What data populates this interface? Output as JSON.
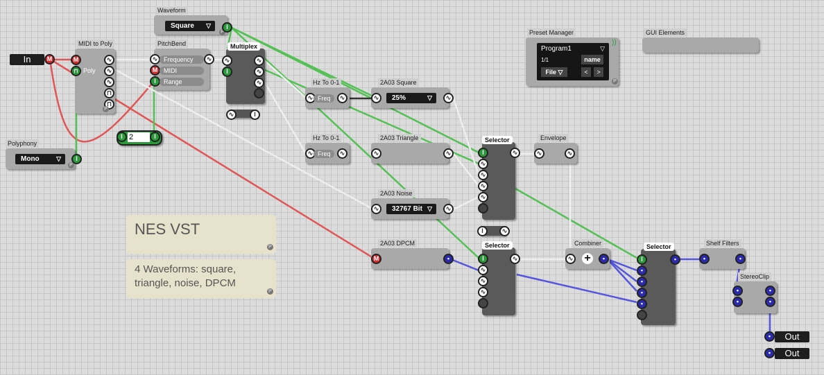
{
  "io": {
    "in_label": "In",
    "out_label": "Out"
  },
  "modules": {
    "waveform": {
      "title": "Waveform",
      "value": "Square"
    },
    "midi_to_poly": {
      "title": "MIDI to Poly",
      "poly_label": "Poly"
    },
    "pitchbend": {
      "title": "PitchBend",
      "frequency": "Frequency",
      "midi": "MIDI",
      "range": "Range"
    },
    "multiplex": {
      "title": "Multiplex"
    },
    "polyphony": {
      "title": "Polyphony",
      "value": "Mono"
    },
    "number_box": {
      "value": "2"
    },
    "hz_to_01_a": {
      "title": "Hz To 0-1",
      "port": "Freq"
    },
    "hz_to_01_b": {
      "title": "Hz To 0-1",
      "port": "Freq"
    },
    "square": {
      "title": "2A03 Square",
      "value": "25%"
    },
    "triangle": {
      "title": "2A03 Triangle"
    },
    "noise": {
      "title": "2A03 Noise",
      "value": "32767 Bit"
    },
    "dpcm": {
      "title": "2A03 DPCM"
    },
    "selector_1": {
      "title": "Selector"
    },
    "selector_2": {
      "title": "Selector"
    },
    "selector_3": {
      "title": "Selector"
    },
    "envelope": {
      "title": "Envelope"
    },
    "combiner": {
      "title": "Combiner"
    },
    "shelf_filters": {
      "title": "Shelf Filters"
    },
    "stereoclip": {
      "title": "StereoClip"
    },
    "preset_manager": {
      "title": "Preset Manager",
      "program": "Program1",
      "count": "1/1",
      "name_btn": "name",
      "file_btn": "File",
      "prev": "<",
      "next": ">"
    },
    "gui_elements": {
      "title": "GUI Elements"
    }
  },
  "notes": {
    "title": "NES VST",
    "desc_line1": "4 Waveforms: square,",
    "desc_line2": "triangle, noise, DPCM"
  },
  "glyphs": {
    "midi": "M",
    "int": "I",
    "audio": "∿",
    "p": "P",
    "plus": "+",
    "dot": "•",
    "dd_arrow": "▽"
  },
  "colors": {
    "red_wire": "#e05555",
    "green_wire": "#55c055",
    "white_wire": "#eeeeee",
    "blue_wire": "#5555dd",
    "dark_wire": "#333333"
  }
}
